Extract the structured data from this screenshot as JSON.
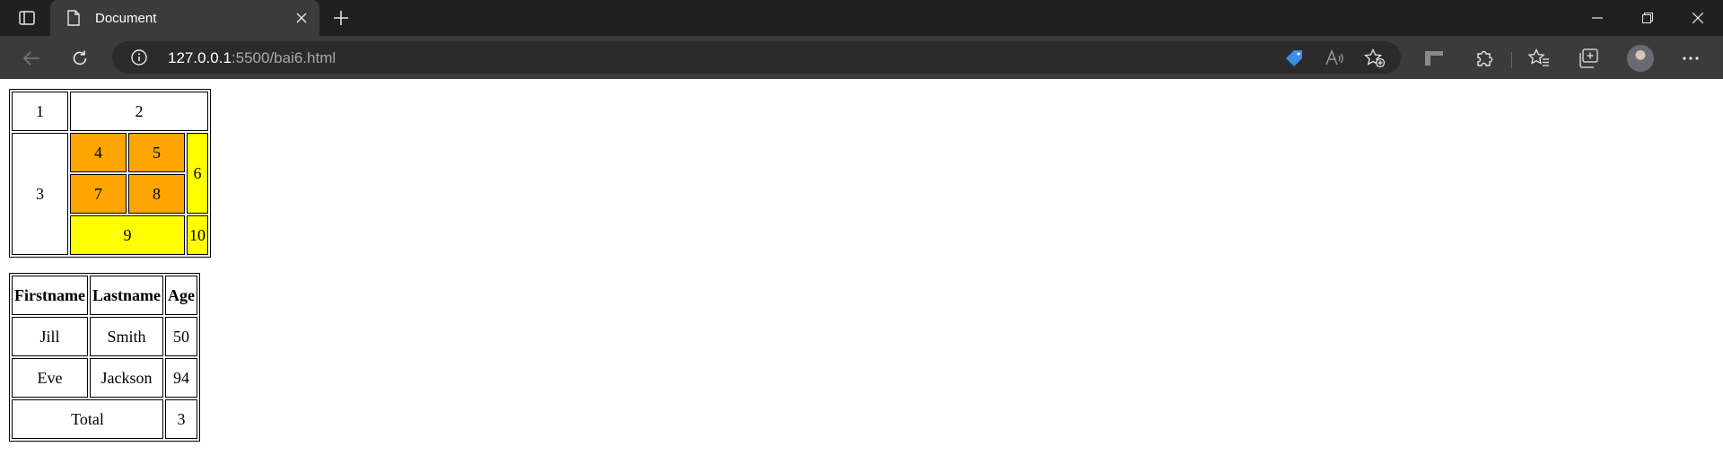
{
  "browser": {
    "tab": {
      "title": "Document"
    },
    "address": {
      "host": "127.0.0.1",
      "rest": ":5500/bai6.html"
    }
  },
  "grid_table": {
    "cells": {
      "c1": "1",
      "c2": "2",
      "c3": "3",
      "c4": "4",
      "c5": "5",
      "c6": "6",
      "c7": "7",
      "c8": "8",
      "c9": "9",
      "c10": "10"
    },
    "colors": {
      "orange": "#ffa500",
      "yellow": "#ffff00"
    }
  },
  "people_table": {
    "headers": [
      "Firstname",
      "Lastname",
      "Age"
    ],
    "rows": [
      [
        "Jill",
        "Smith",
        "50"
      ],
      [
        "Eve",
        "Jackson",
        "94"
      ]
    ],
    "total": {
      "label": "Total",
      "value": "3"
    }
  }
}
